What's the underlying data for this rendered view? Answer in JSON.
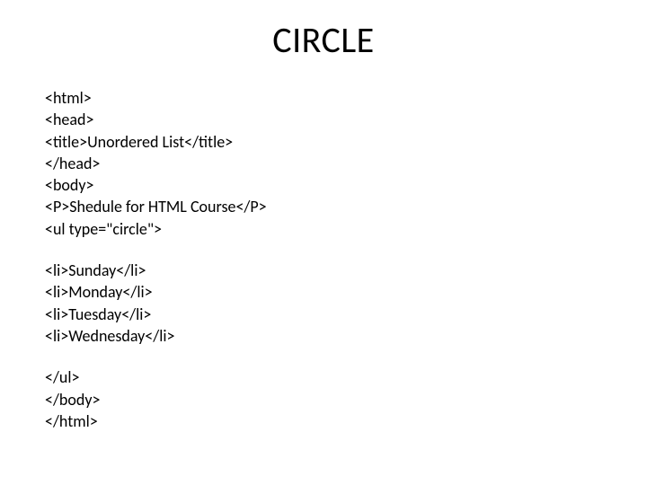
{
  "title": "CIRCLE",
  "code": {
    "block1": [
      "<html>",
      "<head>",
      "<title>Unordered List</title>",
      "</head>",
      "<body>",
      "<P>Shedule for HTML Course</P>",
      "<ul type=\"circle\">"
    ],
    "block2": [
      "<li>Sunday</li>",
      "<li>Monday</li>",
      "<li>Tuesday</li>",
      "<li>Wednesday</li>"
    ],
    "block3": [
      "</ul>",
      "</body>",
      "</html>"
    ]
  }
}
